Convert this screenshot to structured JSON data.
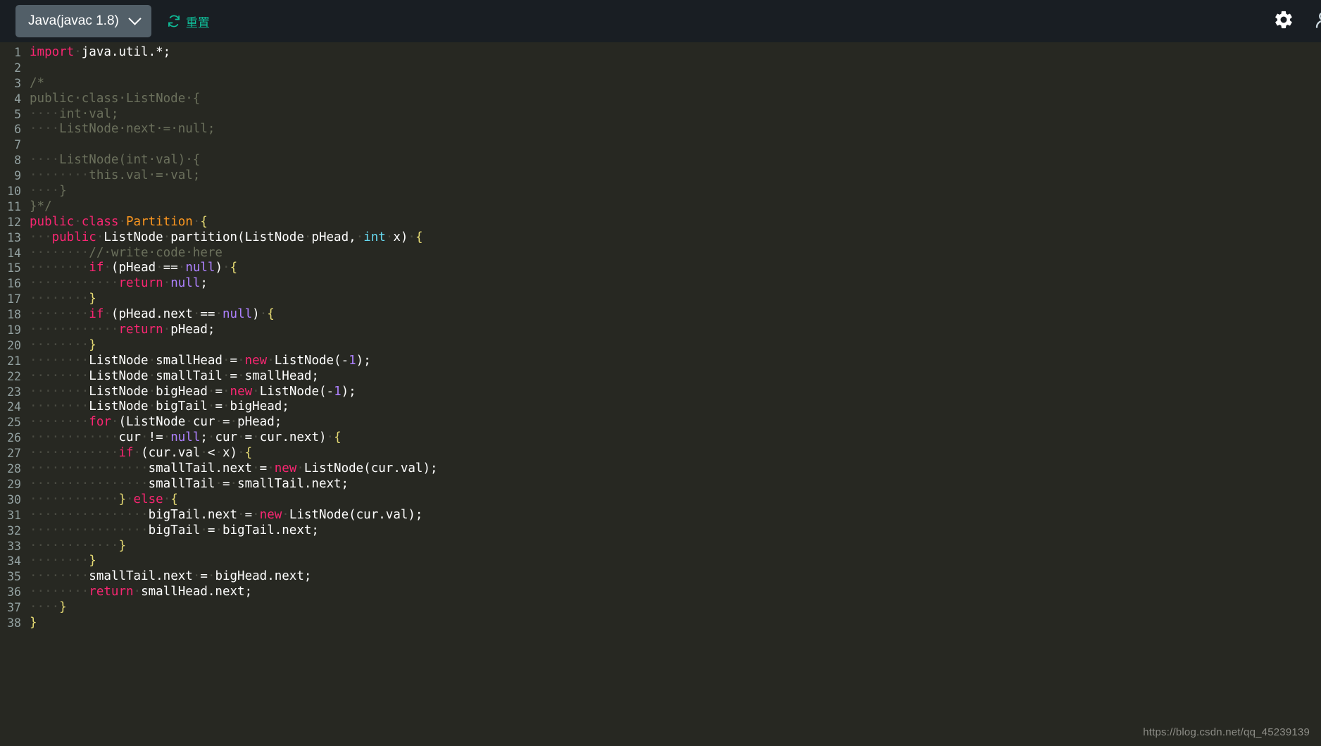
{
  "toolbar": {
    "language_selector": {
      "label": "Java(javac 1.8)",
      "icon": "chevron-down-icon"
    },
    "reset_button": {
      "label": "重置",
      "icon": "refresh-icon",
      "color": "#0fbf9a"
    },
    "settings_icon": "gear-icon",
    "user_icon": "person-icon",
    "background": "#191e23"
  },
  "editor": {
    "background": "#272822",
    "language": "java",
    "colors": {
      "keyword": "#f92672",
      "type": "#fd971f",
      "literal": "#ae81ff",
      "primitive": "#66d9ef",
      "plain": "#ffffff",
      "brace": "#e6db74",
      "comment": "#6b705c",
      "whitespace_dot": "#4a4b42",
      "line_number": "#93a1a1"
    },
    "total_lines": 38,
    "lines": [
      {
        "num": 1,
        "tokens": [
          {
            "c": "k",
            "s": "import"
          },
          {
            "c": "ws",
            "s": "·"
          },
          {
            "c": "p",
            "s": "java.util.*;"
          }
        ]
      },
      {
        "num": 2,
        "tokens": []
      },
      {
        "num": 3,
        "tokens": [
          {
            "c": "cm",
            "s": "/*"
          }
        ]
      },
      {
        "num": 4,
        "tokens": [
          {
            "c": "cm",
            "s": "public·class·ListNode·{"
          }
        ]
      },
      {
        "num": 5,
        "tokens": [
          {
            "c": "ws",
            "s": "····"
          },
          {
            "c": "cm",
            "s": "int·val;"
          }
        ]
      },
      {
        "num": 6,
        "tokens": [
          {
            "c": "ws",
            "s": "····"
          },
          {
            "c": "cm",
            "s": "ListNode·next·=·null;"
          }
        ]
      },
      {
        "num": 7,
        "tokens": []
      },
      {
        "num": 8,
        "tokens": [
          {
            "c": "ws",
            "s": "····"
          },
          {
            "c": "cm",
            "s": "ListNode(int·val)·{"
          }
        ]
      },
      {
        "num": 9,
        "tokens": [
          {
            "c": "ws",
            "s": "········"
          },
          {
            "c": "cm",
            "s": "this.val·=·val;"
          }
        ]
      },
      {
        "num": 10,
        "tokens": [
          {
            "c": "ws",
            "s": "····"
          },
          {
            "c": "cm",
            "s": "}"
          }
        ]
      },
      {
        "num": 11,
        "tokens": [
          {
            "c": "cm",
            "s": "}*/"
          }
        ]
      },
      {
        "num": 12,
        "tokens": [
          {
            "c": "k",
            "s": "public"
          },
          {
            "c": "ws",
            "s": "·"
          },
          {
            "c": "k",
            "s": "class"
          },
          {
            "c": "ws",
            "s": "·"
          },
          {
            "c": "t",
            "s": "Partition"
          },
          {
            "c": "ws",
            "s": "·"
          },
          {
            "c": "br",
            "s": "{"
          }
        ]
      },
      {
        "num": 13,
        "tokens": [
          {
            "c": "ws",
            "s": "···"
          },
          {
            "c": "k",
            "s": "public"
          },
          {
            "c": "ws",
            "s": "·"
          },
          {
            "c": "p",
            "s": "ListNode"
          },
          {
            "c": "ws",
            "s": "·"
          },
          {
            "c": "p",
            "s": "partition(ListNode"
          },
          {
            "c": "ws",
            "s": "·"
          },
          {
            "c": "p",
            "s": "pHead,"
          },
          {
            "c": "ws",
            "s": "·"
          },
          {
            "c": "b",
            "s": "int"
          },
          {
            "c": "ws",
            "s": "·"
          },
          {
            "c": "p",
            "s": "x)"
          },
          {
            "c": "ws",
            "s": "·"
          },
          {
            "c": "br",
            "s": "{"
          }
        ]
      },
      {
        "num": 14,
        "tokens": [
          {
            "c": "ws",
            "s": "········"
          },
          {
            "c": "cm",
            "s": "//·write·code·here"
          }
        ]
      },
      {
        "num": 15,
        "tokens": [
          {
            "c": "ws",
            "s": "········"
          },
          {
            "c": "k",
            "s": "if"
          },
          {
            "c": "ws",
            "s": "·"
          },
          {
            "c": "p",
            "s": "(pHead"
          },
          {
            "c": "ws",
            "s": "·"
          },
          {
            "c": "p",
            "s": "=="
          },
          {
            "c": "ws",
            "s": "·"
          },
          {
            "c": "n",
            "s": "null"
          },
          {
            "c": "p",
            "s": ")"
          },
          {
            "c": "ws",
            "s": "·"
          },
          {
            "c": "br",
            "s": "{"
          }
        ]
      },
      {
        "num": 16,
        "tokens": [
          {
            "c": "ws",
            "s": "············"
          },
          {
            "c": "k",
            "s": "return"
          },
          {
            "c": "ws",
            "s": "·"
          },
          {
            "c": "n",
            "s": "null"
          },
          {
            "c": "p",
            "s": ";"
          }
        ]
      },
      {
        "num": 17,
        "tokens": [
          {
            "c": "ws",
            "s": "········"
          },
          {
            "c": "br",
            "s": "}"
          }
        ]
      },
      {
        "num": 18,
        "tokens": [
          {
            "c": "ws",
            "s": "········"
          },
          {
            "c": "k",
            "s": "if"
          },
          {
            "c": "ws",
            "s": "·"
          },
          {
            "c": "p",
            "s": "(pHead.next"
          },
          {
            "c": "ws",
            "s": "·"
          },
          {
            "c": "p",
            "s": "=="
          },
          {
            "c": "ws",
            "s": "·"
          },
          {
            "c": "n",
            "s": "null"
          },
          {
            "c": "p",
            "s": ")"
          },
          {
            "c": "ws",
            "s": "·"
          },
          {
            "c": "br",
            "s": "{"
          }
        ]
      },
      {
        "num": 19,
        "tokens": [
          {
            "c": "ws",
            "s": "············"
          },
          {
            "c": "k",
            "s": "return"
          },
          {
            "c": "ws",
            "s": "·"
          },
          {
            "c": "p",
            "s": "pHead;"
          }
        ]
      },
      {
        "num": 20,
        "tokens": [
          {
            "c": "ws",
            "s": "········"
          },
          {
            "c": "br",
            "s": "}"
          }
        ]
      },
      {
        "num": 21,
        "tokens": [
          {
            "c": "ws",
            "s": "········"
          },
          {
            "c": "p",
            "s": "ListNode"
          },
          {
            "c": "ws",
            "s": "·"
          },
          {
            "c": "p",
            "s": "smallHead"
          },
          {
            "c": "ws",
            "s": "·"
          },
          {
            "c": "p",
            "s": "="
          },
          {
            "c": "ws",
            "s": "·"
          },
          {
            "c": "k",
            "s": "new"
          },
          {
            "c": "ws",
            "s": "·"
          },
          {
            "c": "p",
            "s": "ListNode(-"
          },
          {
            "c": "n",
            "s": "1"
          },
          {
            "c": "p",
            "s": ");"
          }
        ]
      },
      {
        "num": 22,
        "tokens": [
          {
            "c": "ws",
            "s": "········"
          },
          {
            "c": "p",
            "s": "ListNode"
          },
          {
            "c": "ws",
            "s": "·"
          },
          {
            "c": "p",
            "s": "smallTail"
          },
          {
            "c": "ws",
            "s": "·"
          },
          {
            "c": "p",
            "s": "="
          },
          {
            "c": "ws",
            "s": "·"
          },
          {
            "c": "p",
            "s": "smallHead;"
          }
        ]
      },
      {
        "num": 23,
        "tokens": [
          {
            "c": "ws",
            "s": "········"
          },
          {
            "c": "p",
            "s": "ListNode"
          },
          {
            "c": "ws",
            "s": "·"
          },
          {
            "c": "p",
            "s": "bigHead"
          },
          {
            "c": "ws",
            "s": "·"
          },
          {
            "c": "p",
            "s": "="
          },
          {
            "c": "ws",
            "s": "·"
          },
          {
            "c": "k",
            "s": "new"
          },
          {
            "c": "ws",
            "s": "·"
          },
          {
            "c": "p",
            "s": "ListNode(-"
          },
          {
            "c": "n",
            "s": "1"
          },
          {
            "c": "p",
            "s": ");"
          }
        ]
      },
      {
        "num": 24,
        "tokens": [
          {
            "c": "ws",
            "s": "········"
          },
          {
            "c": "p",
            "s": "ListNode"
          },
          {
            "c": "ws",
            "s": "·"
          },
          {
            "c": "p",
            "s": "bigTail"
          },
          {
            "c": "ws",
            "s": "·"
          },
          {
            "c": "p",
            "s": "="
          },
          {
            "c": "ws",
            "s": "·"
          },
          {
            "c": "p",
            "s": "bigHead;"
          }
        ]
      },
      {
        "num": 25,
        "tokens": [
          {
            "c": "ws",
            "s": "········"
          },
          {
            "c": "k",
            "s": "for"
          },
          {
            "c": "ws",
            "s": "·"
          },
          {
            "c": "p",
            "s": "(ListNode"
          },
          {
            "c": "ws",
            "s": "·"
          },
          {
            "c": "p",
            "s": "cur"
          },
          {
            "c": "ws",
            "s": "·"
          },
          {
            "c": "p",
            "s": "="
          },
          {
            "c": "ws",
            "s": "·"
          },
          {
            "c": "p",
            "s": "pHead;"
          }
        ]
      },
      {
        "num": 26,
        "tokens": [
          {
            "c": "ws",
            "s": "············"
          },
          {
            "c": "p",
            "s": "cur"
          },
          {
            "c": "ws",
            "s": "·"
          },
          {
            "c": "p",
            "s": "!="
          },
          {
            "c": "ws",
            "s": "·"
          },
          {
            "c": "n",
            "s": "null"
          },
          {
            "c": "p",
            "s": ";"
          },
          {
            "c": "ws",
            "s": "·"
          },
          {
            "c": "p",
            "s": "cur"
          },
          {
            "c": "ws",
            "s": "·"
          },
          {
            "c": "p",
            "s": "="
          },
          {
            "c": "ws",
            "s": "·"
          },
          {
            "c": "p",
            "s": "cur.next)"
          },
          {
            "c": "ws",
            "s": "·"
          },
          {
            "c": "br",
            "s": "{"
          }
        ]
      },
      {
        "num": 27,
        "tokens": [
          {
            "c": "ws",
            "s": "············"
          },
          {
            "c": "k",
            "s": "if"
          },
          {
            "c": "ws",
            "s": "·"
          },
          {
            "c": "p",
            "s": "(cur.val"
          },
          {
            "c": "ws",
            "s": "·"
          },
          {
            "c": "p",
            "s": "<"
          },
          {
            "c": "ws",
            "s": "·"
          },
          {
            "c": "p",
            "s": "x)"
          },
          {
            "c": "ws",
            "s": "·"
          },
          {
            "c": "br",
            "s": "{"
          }
        ]
      },
      {
        "num": 28,
        "tokens": [
          {
            "c": "ws",
            "s": "················"
          },
          {
            "c": "p",
            "s": "smallTail.next"
          },
          {
            "c": "ws",
            "s": "·"
          },
          {
            "c": "p",
            "s": "="
          },
          {
            "c": "ws",
            "s": "·"
          },
          {
            "c": "k",
            "s": "new"
          },
          {
            "c": "ws",
            "s": "·"
          },
          {
            "c": "p",
            "s": "ListNode(cur.val);"
          }
        ]
      },
      {
        "num": 29,
        "tokens": [
          {
            "c": "ws",
            "s": "················"
          },
          {
            "c": "p",
            "s": "smallTail"
          },
          {
            "c": "ws",
            "s": "·"
          },
          {
            "c": "p",
            "s": "="
          },
          {
            "c": "ws",
            "s": "·"
          },
          {
            "c": "p",
            "s": "smallTail.next;"
          }
        ]
      },
      {
        "num": 30,
        "tokens": [
          {
            "c": "ws",
            "s": "············"
          },
          {
            "c": "br",
            "s": "}"
          },
          {
            "c": "ws",
            "s": "·"
          },
          {
            "c": "k",
            "s": "else"
          },
          {
            "c": "ws",
            "s": "·"
          },
          {
            "c": "br",
            "s": "{"
          }
        ]
      },
      {
        "num": 31,
        "tokens": [
          {
            "c": "ws",
            "s": "················"
          },
          {
            "c": "p",
            "s": "bigTail.next"
          },
          {
            "c": "ws",
            "s": "·"
          },
          {
            "c": "p",
            "s": "="
          },
          {
            "c": "ws",
            "s": "·"
          },
          {
            "c": "k",
            "s": "new"
          },
          {
            "c": "ws",
            "s": "·"
          },
          {
            "c": "p",
            "s": "ListNode(cur.val);"
          }
        ]
      },
      {
        "num": 32,
        "tokens": [
          {
            "c": "ws",
            "s": "················"
          },
          {
            "c": "p",
            "s": "bigTail"
          },
          {
            "c": "ws",
            "s": "·"
          },
          {
            "c": "p",
            "s": "="
          },
          {
            "c": "ws",
            "s": "·"
          },
          {
            "c": "p",
            "s": "bigTail.next;"
          }
        ]
      },
      {
        "num": 33,
        "tokens": [
          {
            "c": "ws",
            "s": "············"
          },
          {
            "c": "br",
            "s": "}"
          }
        ]
      },
      {
        "num": 34,
        "tokens": [
          {
            "c": "ws",
            "s": "········"
          },
          {
            "c": "br",
            "s": "}"
          }
        ]
      },
      {
        "num": 35,
        "tokens": [
          {
            "c": "ws",
            "s": "········"
          },
          {
            "c": "p",
            "s": "smallTail.next"
          },
          {
            "c": "ws",
            "s": "·"
          },
          {
            "c": "p",
            "s": "="
          },
          {
            "c": "ws",
            "s": "·"
          },
          {
            "c": "p",
            "s": "bigHead.next;"
          }
        ]
      },
      {
        "num": 36,
        "tokens": [
          {
            "c": "ws",
            "s": "········"
          },
          {
            "c": "k",
            "s": "return"
          },
          {
            "c": "ws",
            "s": "·"
          },
          {
            "c": "p",
            "s": "smallHead.next;"
          }
        ]
      },
      {
        "num": 37,
        "tokens": [
          {
            "c": "ws",
            "s": "····"
          },
          {
            "c": "br",
            "s": "}"
          }
        ]
      },
      {
        "num": 38,
        "tokens": [
          {
            "c": "br",
            "s": "}"
          }
        ]
      }
    ]
  },
  "watermark": {
    "text": "https://blog.csdn.net/qq_45239139"
  }
}
